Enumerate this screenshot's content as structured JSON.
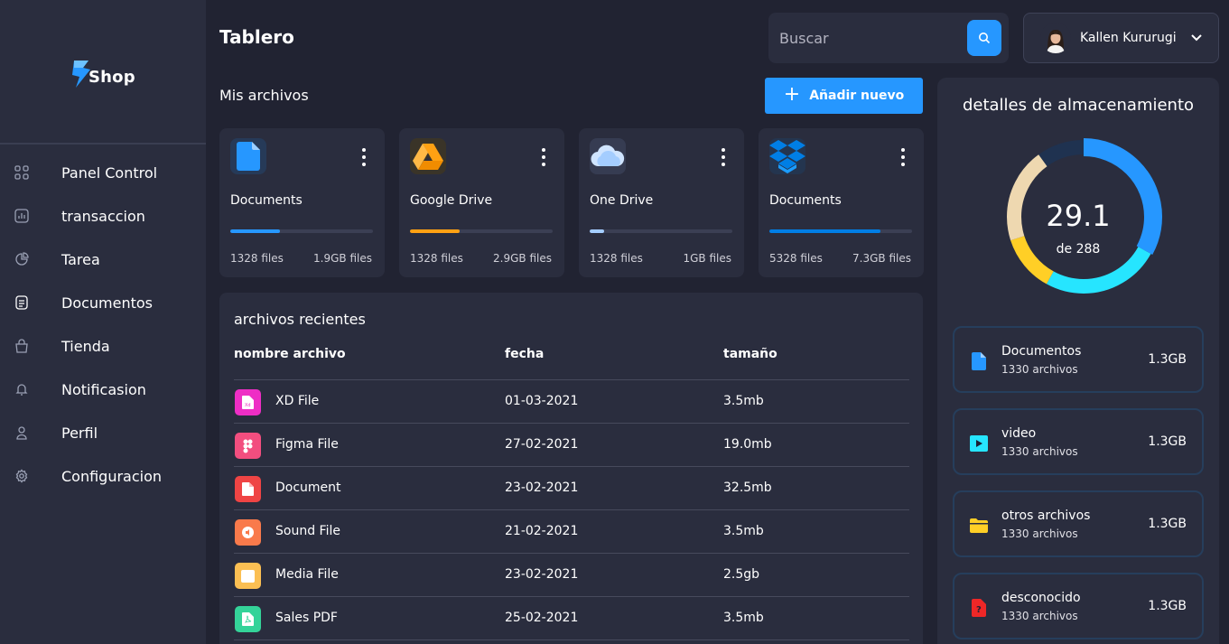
{
  "brand": {
    "name": "Shop"
  },
  "sidebar": {
    "items": [
      {
        "label": "Panel Control",
        "icon": "dashboard-icon"
      },
      {
        "label": "transaccion",
        "icon": "transaction-icon"
      },
      {
        "label": "Tarea",
        "icon": "task-icon"
      },
      {
        "label": "Documentos",
        "icon": "document-icon"
      },
      {
        "label": "Tienda",
        "icon": "store-icon"
      },
      {
        "label": "Notificasion",
        "icon": "bell-icon"
      },
      {
        "label": "Perfil",
        "icon": "user-icon"
      },
      {
        "label": "Configuracion",
        "icon": "gear-icon"
      }
    ]
  },
  "header": {
    "title": "Tablero",
    "search_placeholder": "Buscar",
    "profile_name": "Kallen Kururugi"
  },
  "files": {
    "title": "Mis archivos",
    "add_label": "Añadir nuevo",
    "cards": [
      {
        "title": "Documents",
        "count": "1328 files",
        "size": "1.9GB files",
        "percent": 35,
        "color": "#2697ff",
        "icon": "document-icon"
      },
      {
        "title": "Google Drive",
        "count": "1328 files",
        "size": "2.9GB files",
        "percent": 35,
        "color": "#ffa113",
        "icon": "google-drive-icon"
      },
      {
        "title": "One Drive",
        "count": "1328 files",
        "size": "1GB files",
        "percent": 10,
        "color": "#a4cdff",
        "icon": "cloud-icon"
      },
      {
        "title": "Documents",
        "count": "5328 files",
        "size": "7.3GB files",
        "percent": 78,
        "color": "#007ee5",
        "icon": "dropbox-icon"
      }
    ]
  },
  "recent": {
    "title": "archivos recientes",
    "columns": [
      "nombre archivo",
      "fecha",
      "tamaño"
    ],
    "rows": [
      {
        "name": "XD File",
        "date": "01-03-2021",
        "size": "3.5mb",
        "color": "#ee2ec5",
        "icon": "xd-file-icon"
      },
      {
        "name": "Figma File",
        "date": "27-02-2021",
        "size": "19.0mb",
        "color": "#f24e7f",
        "icon": "figma-file-icon"
      },
      {
        "name": "Document",
        "date": "23-02-2021",
        "size": "32.5mb",
        "color": "#ef4444",
        "icon": "document-file-icon"
      },
      {
        "name": "Sound File",
        "date": "21-02-2021",
        "size": "3.5mb",
        "color": "#f97a4b",
        "icon": "sound-file-icon"
      },
      {
        "name": "Media File",
        "date": "23-02-2021",
        "size": "2.5gb",
        "color": "#fbbf53",
        "icon": "media-file-icon"
      },
      {
        "name": "Sales PDF",
        "date": "25-02-2021",
        "size": "3.5mb",
        "color": "#34d399",
        "icon": "pdf-file-icon"
      }
    ]
  },
  "storage": {
    "title": "detalles de almacenamiento",
    "used": "29.1",
    "total_label": "de 288",
    "segments": [
      {
        "color": "#2697ff",
        "value": 33
      },
      {
        "color": "#26e5ff",
        "value": 25
      },
      {
        "color": "#ffcf26",
        "value": 12
      },
      {
        "color": "#eed8b0",
        "value": 20
      },
      {
        "color": "#1f3250",
        "value": 10
      }
    ],
    "items": [
      {
        "name": "Documentos",
        "count": "1330 archivos",
        "size": "1.3GB",
        "icon": "document-icon",
        "color": "#2697ff"
      },
      {
        "name": "video",
        "count": "1330 archivos",
        "size": "1.3GB",
        "icon": "video-icon",
        "color": "#26e5ff"
      },
      {
        "name": "otros archivos",
        "count": "1330 archivos",
        "size": "1.3GB",
        "icon": "folder-icon",
        "color": "#ffcf26"
      },
      {
        "name": "desconocido",
        "count": "1330 archivos",
        "size": "1.3GB",
        "icon": "unknown-file-icon",
        "color": "#ee2727"
      }
    ]
  }
}
